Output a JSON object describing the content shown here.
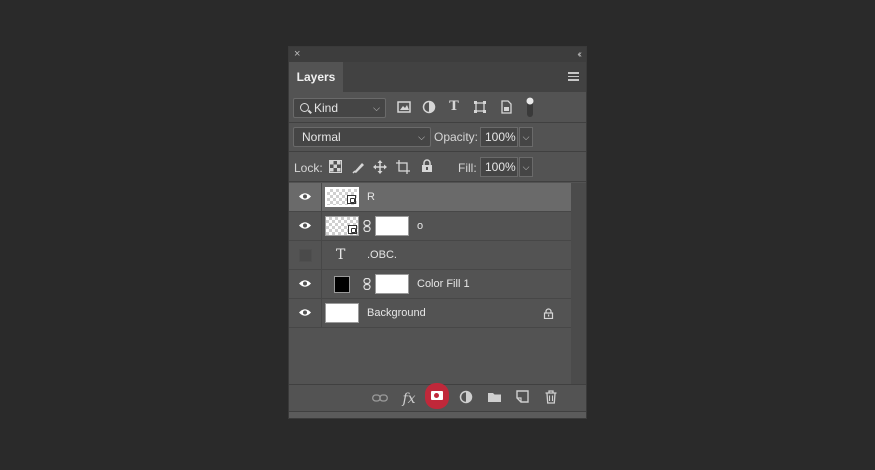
{
  "panel": {
    "tab_label": "Layers",
    "close_glyph": "×",
    "collapse_glyph": "‹‹"
  },
  "filter": {
    "kind_label": "Kind",
    "type_glyph": "T",
    "icons": [
      "image-filter-icon",
      "adjustment-filter-icon",
      "type-filter-icon",
      "shape-filter-icon",
      "smart-object-filter-icon",
      "filter-toggle-icon"
    ]
  },
  "blend": {
    "mode": "Normal",
    "opacity_label": "Opacity:",
    "opacity_value": "100%"
  },
  "lock": {
    "label": "Lock:",
    "fill_label": "Fill:",
    "fill_value": "100%"
  },
  "layers": [
    {
      "name": "R",
      "visible": true,
      "selected": true,
      "kind": "smart-object"
    },
    {
      "name": "o",
      "visible": true,
      "selected": false,
      "kind": "smart-object-masked"
    },
    {
      "name": ".OBC.",
      "visible": false,
      "selected": false,
      "kind": "type"
    },
    {
      "name": "Color Fill 1",
      "visible": true,
      "selected": false,
      "kind": "fill"
    },
    {
      "name": "Background",
      "visible": true,
      "selected": false,
      "kind": "background",
      "locked": true
    }
  ],
  "bottom": {
    "fx_label": "fx",
    "highlight_color": "#c0283a",
    "icons": [
      "link-layers-icon",
      "fx-icon",
      "add-mask-icon",
      "adjustment-layer-icon",
      "new-group-icon",
      "new-layer-icon",
      "delete-layer-icon"
    ]
  }
}
